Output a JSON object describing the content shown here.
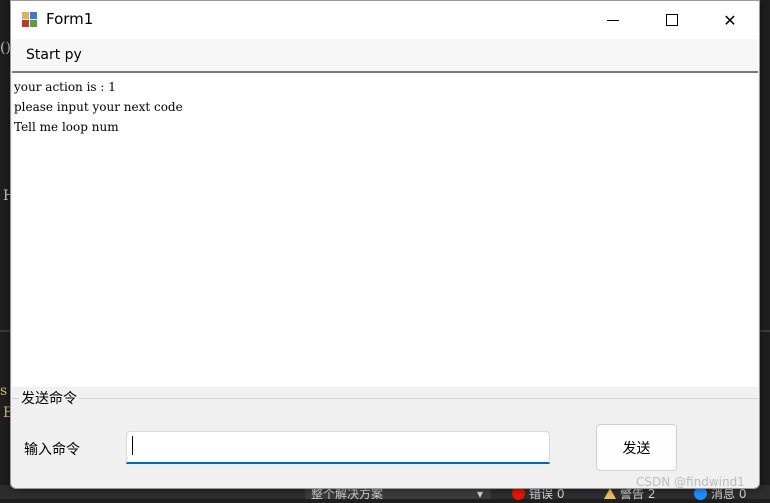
{
  "window": {
    "title": "Form1"
  },
  "menu": {
    "items": [
      {
        "label": "Start py"
      }
    ]
  },
  "output": {
    "lines": [
      "your action is : 1",
      "please input your next code",
      "Tell me loop num"
    ]
  },
  "command_group": {
    "legend": "发送命令",
    "label": "输入命令",
    "input_value": "",
    "send_label": "发送"
  },
  "background_ide": {
    "status_items": [
      "整个解决方案",
      "错误 0",
      "警告 2",
      "消息 0"
    ]
  },
  "watermark": "CSDN @findwind1",
  "colors": {
    "accent": "#0067c0",
    "window_bg": "#f0f0f0",
    "ide_bg": "#1e1e1e"
  }
}
